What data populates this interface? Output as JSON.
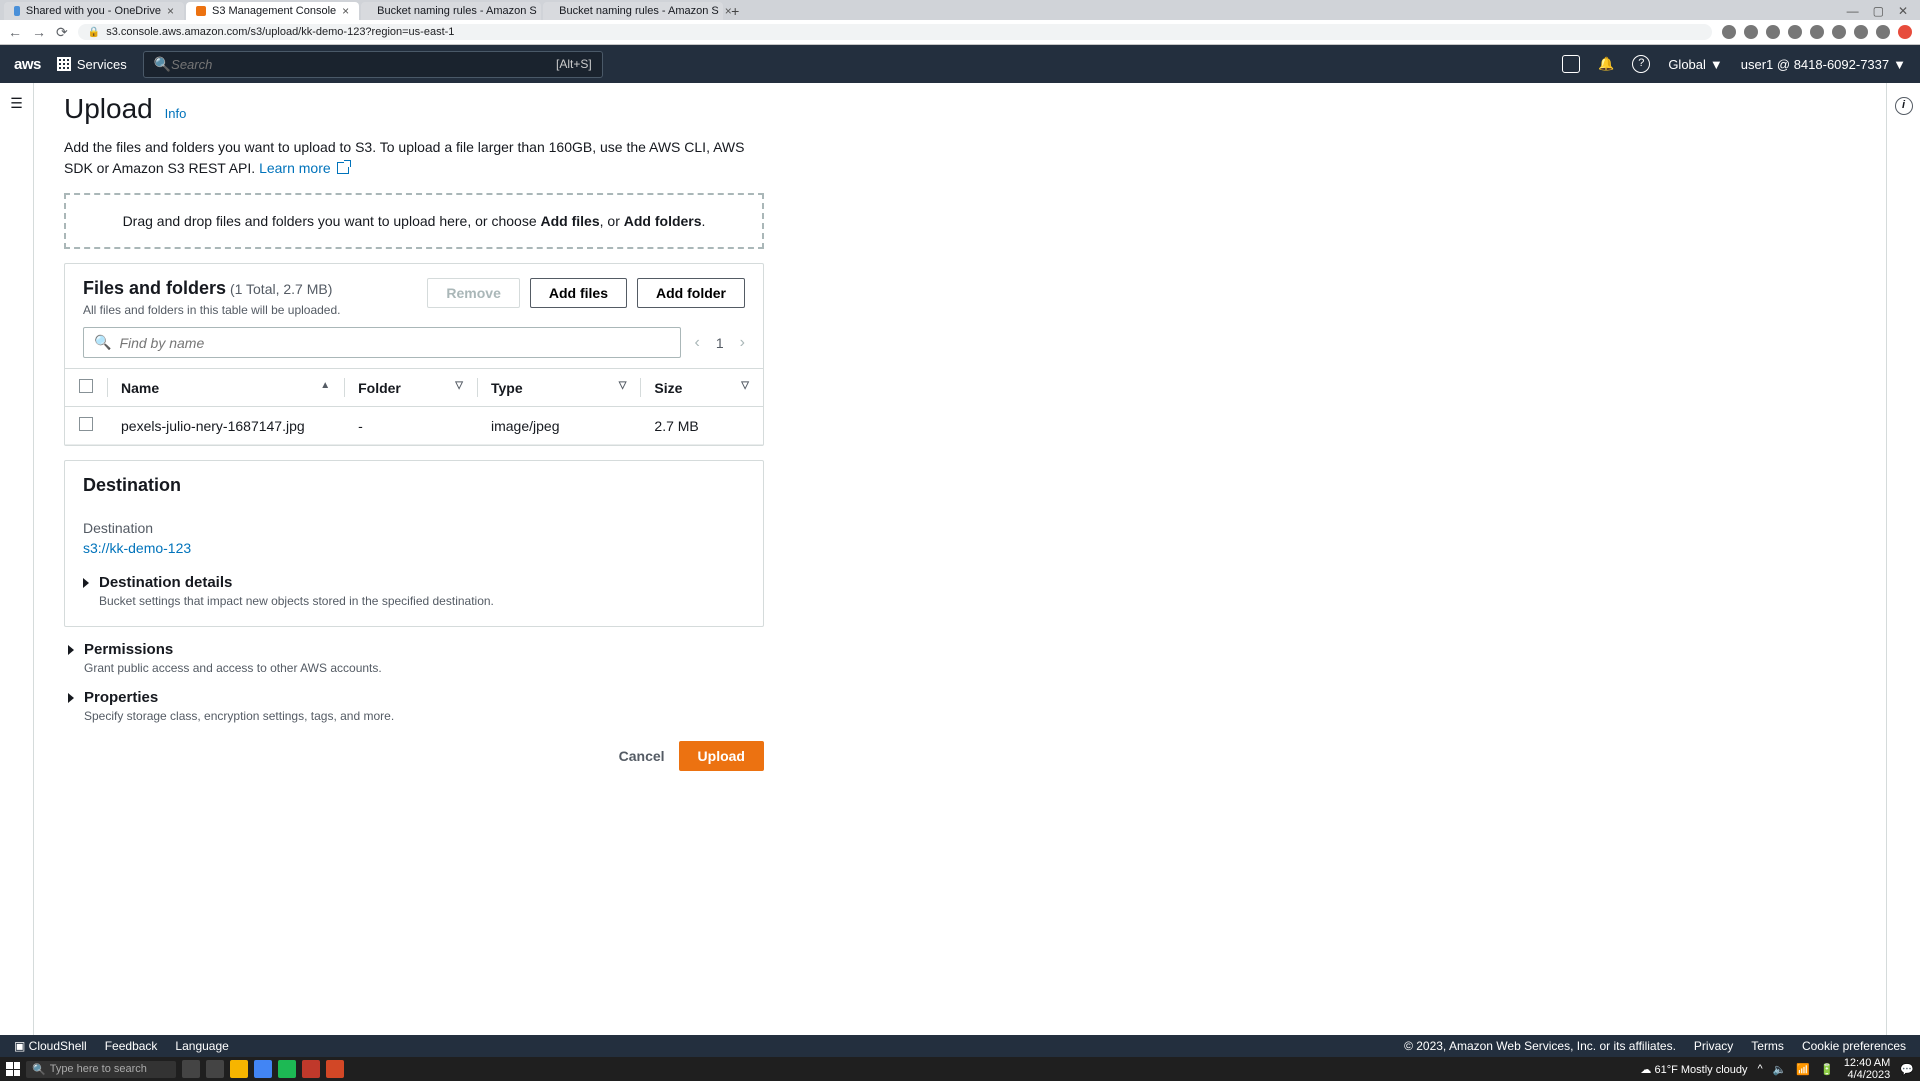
{
  "browser": {
    "tabs": [
      {
        "title": "Shared with you - OneDrive"
      },
      {
        "title": "S3 Management Console"
      },
      {
        "title": "Bucket naming rules - Amazon S"
      },
      {
        "title": "Bucket naming rules - Amazon S"
      }
    ],
    "url": "s3.console.aws.amazon.com/s3/upload/kk-demo-123?region=us-east-1"
  },
  "nav": {
    "services": "Services",
    "search_placeholder": "Search",
    "search_hint": "[Alt+S]",
    "region": "Global",
    "user": "user1 @ 8418-6092-7337"
  },
  "page": {
    "title": "Upload",
    "info": "Info",
    "intro_a": "Add the files and folders you want to upload to S3. To upload a file larger than 160GB, use the AWS CLI, AWS SDK or Amazon S3 REST API. ",
    "learn_more": "Learn more",
    "drop_a": "Drag and drop files and folders you want to upload here, or choose ",
    "drop_b": "Add files",
    "drop_c": ", or ",
    "drop_d": "Add folders",
    "drop_e": "."
  },
  "files": {
    "title": "Files and folders",
    "count": "(1 Total, 2.7 MB)",
    "sub": "All files and folders in this table will be uploaded.",
    "remove": "Remove",
    "add_files": "Add files",
    "add_folder": "Add folder",
    "find_placeholder": "Find by name",
    "page": "1",
    "cols": {
      "name": "Name",
      "folder": "Folder",
      "type": "Type",
      "size": "Size"
    },
    "rows": [
      {
        "name": "pexels-julio-nery-1687147.jpg",
        "folder": "-",
        "type": "image/jpeg",
        "size": "2.7 MB"
      }
    ]
  },
  "destination": {
    "title": "Destination",
    "label": "Destination",
    "path": "s3://kk-demo-123",
    "details_title": "Destination details",
    "details_sub": "Bucket settings that impact new objects stored in the specified destination."
  },
  "permissions": {
    "title": "Permissions",
    "sub": "Grant public access and access to other AWS accounts."
  },
  "properties": {
    "title": "Properties",
    "sub": "Specify storage class, encryption settings, tags, and more."
  },
  "actions": {
    "cancel": "Cancel",
    "upload": "Upload"
  },
  "footer": {
    "cloudshell": "CloudShell",
    "feedback": "Feedback",
    "language": "Language",
    "copy": "© 2023, Amazon Web Services, Inc. or its affiliates.",
    "privacy": "Privacy",
    "terms": "Terms",
    "cookies": "Cookie preferences"
  },
  "taskbar": {
    "search": "Type here to search",
    "weather": "61°F Mostly cloudy",
    "time": "12:40 AM",
    "date": "4/4/2023"
  }
}
